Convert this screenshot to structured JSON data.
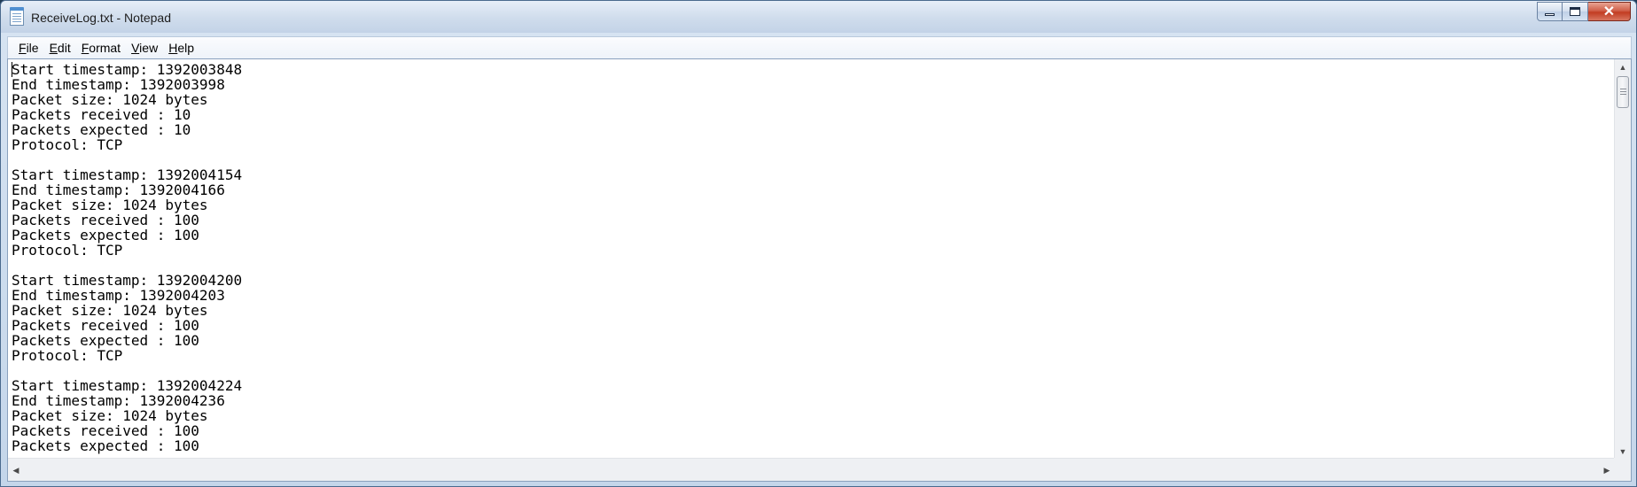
{
  "window": {
    "title": "ReceiveLog.txt - Notepad",
    "icon": "notepad-icon"
  },
  "menu": [
    {
      "accel": "F",
      "rest": "ile"
    },
    {
      "accel": "E",
      "rest": "dit"
    },
    {
      "accel": "F",
      "rest": "ormat",
      "prefix": ""
    },
    {
      "accel": "V",
      "rest": "iew"
    },
    {
      "accel": "H",
      "rest": "elp"
    }
  ],
  "lines": [
    "Start timestamp: 1392003848",
    "End timestamp: 1392003998",
    "Packet size: 1024 bytes",
    "Packets received : 10",
    "Packets expected : 10",
    "Protocol: TCP",
    "",
    "Start timestamp: 1392004154",
    "End timestamp: 1392004166",
    "Packet size: 1024 bytes",
    "Packets received : 100",
    "Packets expected : 100",
    "Protocol: TCP",
    "",
    "Start timestamp: 1392004200",
    "End timestamp: 1392004203",
    "Packet size: 1024 bytes",
    "Packets received : 100",
    "Packets expected : 100",
    "Protocol: TCP",
    "",
    "Start timestamp: 1392004224",
    "End timestamp: 1392004236",
    "Packet size: 1024 bytes",
    "Packets received : 100",
    "Packets expected : 100"
  ],
  "scrollbars": {
    "up_arrow": "▲",
    "down_arrow": "▼",
    "left_arrow": "◀",
    "right_arrow": "▶"
  },
  "buttons": {
    "close_glyph": "✕"
  }
}
